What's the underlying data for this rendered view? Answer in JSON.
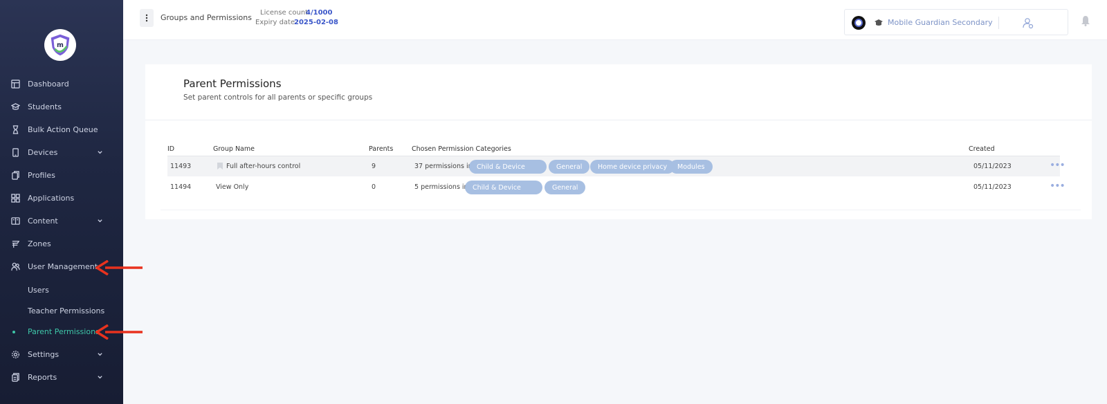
{
  "sidebar": {
    "items": [
      {
        "label": "Dashboard",
        "icon": "layout-icon"
      },
      {
        "label": "Students",
        "icon": "student-icon"
      },
      {
        "label": "Bulk Action Queue",
        "icon": "hourglass-icon"
      },
      {
        "label": "Devices",
        "icon": "device-icon"
      },
      {
        "label": "Profiles",
        "icon": "profile-icon"
      },
      {
        "label": "Applications",
        "icon": "grid-icon"
      },
      {
        "label": "Content",
        "icon": "content-icon"
      },
      {
        "label": "Zones",
        "icon": "zone-icon"
      },
      {
        "label": "User Management",
        "icon": "users-icon"
      },
      {
        "label": "Settings",
        "icon": "gear-icon"
      },
      {
        "label": "Reports",
        "icon": "report-icon"
      }
    ],
    "sub_items": [
      {
        "label": "Users"
      },
      {
        "label": "Teacher Permissions"
      },
      {
        "label": "Parent Permissions"
      }
    ]
  },
  "topbar": {
    "title": "Groups and Permissions",
    "license_label": "License count",
    "license_value": "4/1000",
    "expiry_label": "Expiry date",
    "expiry_value": "2025-02-08",
    "school_name": "Mobile Guardian Secondary"
  },
  "card": {
    "title": "Parent Permissions",
    "subtitle": "Set parent controls for all parents or specific groups"
  },
  "table": {
    "headers": {
      "id": "ID",
      "group": "Group Name",
      "parents": "Parents",
      "categories": "Chosen Permission Categories",
      "created": "Created"
    },
    "rows": [
      {
        "id": "11493",
        "group": "Full after-hours control",
        "parents": "9",
        "perm_text": "37 permissions in",
        "pills": [
          "Child & Device",
          "General",
          "Home device privacy",
          "Modules"
        ],
        "created": "05/11/2023"
      },
      {
        "id": "11494",
        "group": "View Only",
        "parents": "0",
        "perm_text": "5 permissions in",
        "pills": [
          "Child & Device",
          "General"
        ],
        "created": "05/11/2023"
      }
    ]
  },
  "colors": {
    "accent": "#3ec7a8",
    "pill": "#a7bfe2",
    "link": "#3a56c9",
    "arrow": "#e8321e"
  }
}
